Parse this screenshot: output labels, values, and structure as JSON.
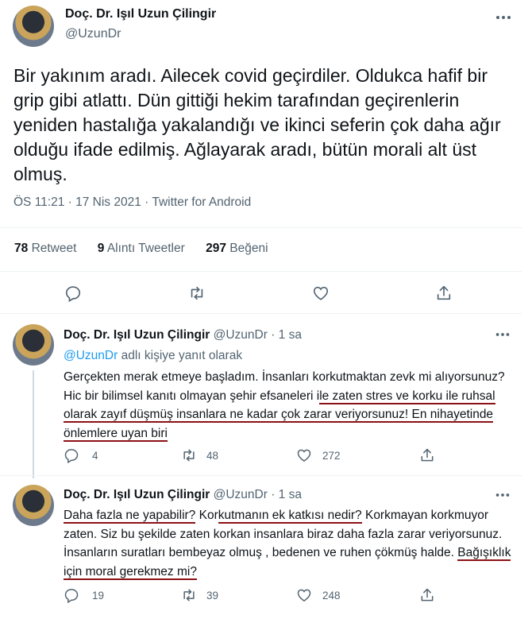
{
  "main": {
    "name": "Doç. Dr. Işıl Uzun Çilingir",
    "handle": "@UzunDr",
    "text": "Bir yakınım aradı. Ailecek covid geçirdiler. Oldukca hafif bir grip gibi atlattı. Dün gittiği  hekim tarafından geçirenlerin  yeniden hastalığa yakalandığı ve ikinci seferin çok daha ağır olduğu  ifade edilmiş. Ağlayarak aradı, bütün morali alt üst olmuş.",
    "meta": "ÖS 11:21 · 17 Nis 2021 · Twitter for Android",
    "retweet_count": "78",
    "retweet_label": "Retweet",
    "quote_count": "9",
    "quote_label": "Alıntı Tweetler",
    "like_count": "297",
    "like_label": "Beğeni"
  },
  "replies": [
    {
      "name": "Doç. Dr. Işıl Uzun Çilingir",
      "handle": "@UzunDr",
      "time": "· 1 sa",
      "reply_to_handle": "@UzunDr",
      "reply_to_suffix": "adlı kişiye yanıt olarak",
      "text_1": "Gerçekten merak etmeye başladım. İnsanları korkutmaktan zevk mi alıyorsunuz? Hic bir bilimsel kanıtı olmayan şehir efsaneleri i",
      "text_2": "le zaten stres ve korku ile ruhsal olarak zayıf düşmüş insanlara ne kadar çok zarar veriyorsunuz! En nihayetinde önlemlere uyan biri",
      "replies": "4",
      "retweets": "48",
      "likes": "272"
    },
    {
      "name": "Doç. Dr. Işıl Uzun Çilingir",
      "handle": "@UzunDr",
      "time": "· 1 sa",
      "text_1": "Daha fazla ne yapabilir?",
      "text_2": " Kor",
      "text_3": "kutmanın ek katkısı nedir?",
      "text_4": " Korkmayan korkmuyor zaten. Siz bu şekilde zaten korkan insanlara biraz daha fazla zarar veriyorsunuz. İnsanların  suratları bembeyaz olmuş , bedenen ve ruhen çökmüş halde. ",
      "text_5": "Bağışıklık için moral gerekmez mi?",
      "replies": "19",
      "retweets": "39",
      "likes": "248"
    }
  ],
  "icons": {
    "more": "more-icon",
    "reply": "reply-icon",
    "retweet": "retweet-icon",
    "like": "heart-icon",
    "share": "share-icon"
  },
  "colors": {
    "accent": "#1d9bf0",
    "text": "#0f1419",
    "secondary": "#536471",
    "underline": "#8b1116"
  }
}
